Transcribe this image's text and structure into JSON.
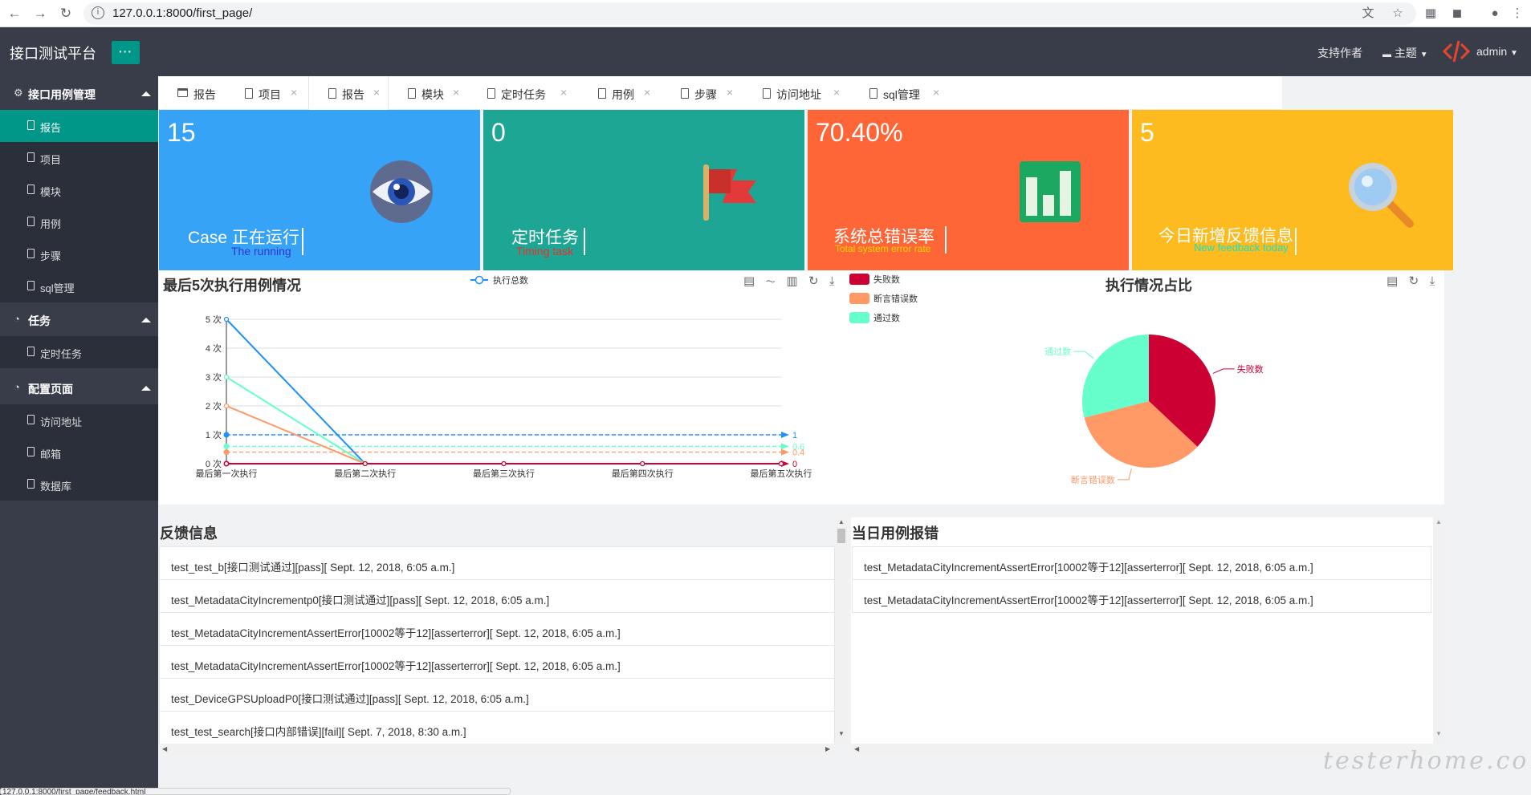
{
  "browser": {
    "url": "127.0.0.1:8000/first_page/",
    "status_url": "127.0.0.1:8000/first_page/feedback.html"
  },
  "header": {
    "app_title": "接口测试平台",
    "menu_toggle": "···",
    "support": "支持作者",
    "theme": "主题",
    "user": "admin"
  },
  "sidebar": {
    "groups": [
      {
        "label": "接口用例管理",
        "items": [
          "报告",
          "项目",
          "模块",
          "用例",
          "步骤",
          "sql管理"
        ]
      },
      {
        "label": "任务",
        "items": [
          "定时任务"
        ]
      },
      {
        "label": "配置页面",
        "items": [
          "访问地址",
          "邮箱",
          "数据库"
        ]
      }
    ]
  },
  "tabs": [
    {
      "label": "报告",
      "closable": false
    },
    {
      "label": "项目",
      "closable": true
    },
    {
      "label": "报告",
      "closable": true,
      "active": true
    },
    {
      "label": "模块",
      "closable": true
    },
    {
      "label": "定时任务",
      "closable": true
    },
    {
      "label": "用例",
      "closable": true
    },
    {
      "label": "步骤",
      "closable": true
    },
    {
      "label": "访问地址",
      "closable": true
    },
    {
      "label": "sql管理",
      "closable": true
    }
  ],
  "cards": [
    {
      "value": "15",
      "title": "Case 正在运行",
      "subtitle": "The running",
      "color": "#36a3f7",
      "sub_color": "#3333cc",
      "icon": "eye-icon"
    },
    {
      "value": "0",
      "title": "定时任务",
      "subtitle": "Timing task",
      "color": "#1ea694",
      "sub_color": "#e8312f",
      "icon": "flag-icon"
    },
    {
      "value": "70.40%",
      "title": "系统总错误率",
      "subtitle": "Total system error rate",
      "color": "#fe6638",
      "sub_color": "#ffd700",
      "icon": "bar-chart-icon"
    },
    {
      "value": "5",
      "title": "今日新增反馈信息",
      "subtitle": "New feedback today",
      "color": "#fdbb1f",
      "sub_color": "#17e3c0",
      "icon": "magnifier-icon"
    }
  ],
  "line_chart_title": "最后5次执行用例情况",
  "pie_chart_title": "执行情况占比",
  "chart_data": [
    {
      "type": "line",
      "title": "最后5次执行用例情况",
      "categories": [
        "最后第一次执行",
        "最后第二次执行",
        "最后第三次执行",
        "最后第四次执行",
        "最后第五次执行"
      ],
      "y_tick_labels": [
        "0 次",
        "1 次",
        "2 次",
        "3 次",
        "4 次",
        "5 次"
      ],
      "ylim": [
        0,
        5
      ],
      "legend": [
        "执行总数"
      ],
      "series": [
        {
          "name": "执行总数",
          "values": [
            5,
            0,
            0,
            0,
            0
          ],
          "color": "#1e90ff"
        },
        {
          "name": "通过数",
          "values": [
            3,
            0,
            0,
            0,
            0
          ],
          "color": "#66ffcc"
        },
        {
          "name": "断言错误数",
          "values": [
            2,
            0,
            0,
            0,
            0
          ],
          "color": "#ff9966"
        },
        {
          "name": "失败数",
          "values": [
            0,
            0,
            0,
            0,
            0
          ],
          "color": "#cc0033"
        }
      ],
      "average_lines": [
        {
          "value": 1,
          "label": "1",
          "color": "#1e90ff"
        },
        {
          "value": 0.6,
          "label": "0.6",
          "color": "#66ffcc"
        },
        {
          "value": 0.4,
          "label": "0.4",
          "color": "#ff9966"
        },
        {
          "value": 0,
          "label": "0",
          "color": "#cc0033"
        }
      ]
    },
    {
      "type": "pie",
      "title": "执行情况占比",
      "legend": [
        "失败数",
        "断言错误数",
        "通过数"
      ],
      "slices": [
        {
          "label": "失败数",
          "value": 37,
          "color": "#cc0033"
        },
        {
          "label": "断言错误数",
          "value": 34,
          "color": "#ff9966"
        },
        {
          "label": "通过数",
          "value": 29,
          "color": "#66ffcc"
        }
      ]
    }
  ],
  "feedback": {
    "title": "反馈信息",
    "rows": [
      "test_test_b[接口测试通过][pass][ Sept. 12, 2018, 6:05 a.m.]",
      "test_MetadataCityIncrementp0[接口测试通过][pass][ Sept. 12, 2018, 6:05 a.m.]",
      "test_MetadataCityIncrementAssertError[10002等于12][asserterror][ Sept. 12, 2018, 6:05 a.m.]",
      "test_MetadataCityIncrementAssertError[10002等于12][asserterror][ Sept. 12, 2018, 6:05 a.m.]",
      "test_DeviceGPSUploadP0[接口测试通过][pass][ Sept. 12, 2018, 6:05 a.m.]",
      "test_test_search[接口内部错误][fail][ Sept. 7, 2018, 8:30 a.m.]"
    ]
  },
  "today_errors": {
    "title": "当日用例报错",
    "rows": [
      "test_MetadataCityIncrementAssertError[10002等于12][asserterror][ Sept. 12, 2018, 6:05 a.m.]",
      "test_MetadataCityIncrementAssertError[10002等于12][asserterror][ Sept. 12, 2018, 6:05 a.m.]"
    ]
  },
  "watermark": "testerhome.com"
}
